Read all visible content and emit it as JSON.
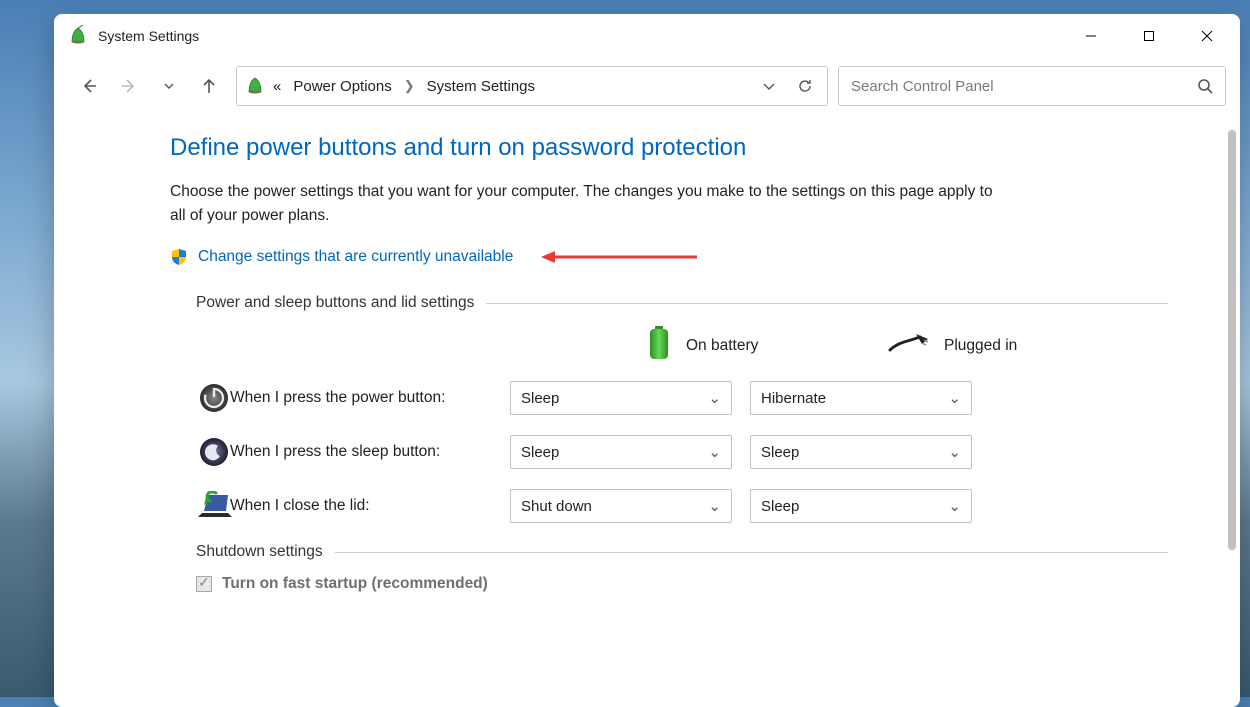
{
  "window": {
    "title": "System Settings"
  },
  "breadcrumb": {
    "prefix": "«",
    "items": [
      "Power Options",
      "System Settings"
    ]
  },
  "search": {
    "placeholder": "Search Control Panel"
  },
  "page": {
    "title": "Define power buttons and turn on password protection",
    "subtitle": "Choose the power settings that you want for your computer. The changes you make to the settings on this page apply to all of your power plans.",
    "change_link": "Change settings that are currently unavailable"
  },
  "section1": {
    "title": "Power and sleep buttons and lid settings",
    "col_battery": "On battery",
    "col_plugged": "Plugged in",
    "rows": [
      {
        "label": "When I press the power button:",
        "battery": "Sleep",
        "plugged": "Hibernate"
      },
      {
        "label": "When I press the sleep button:",
        "battery": "Sleep",
        "plugged": "Sleep"
      },
      {
        "label": "When I close the lid:",
        "battery": "Shut down",
        "plugged": "Sleep"
      }
    ]
  },
  "section2": {
    "title": "Shutdown settings",
    "fast_startup": "Turn on fast startup (recommended)"
  }
}
